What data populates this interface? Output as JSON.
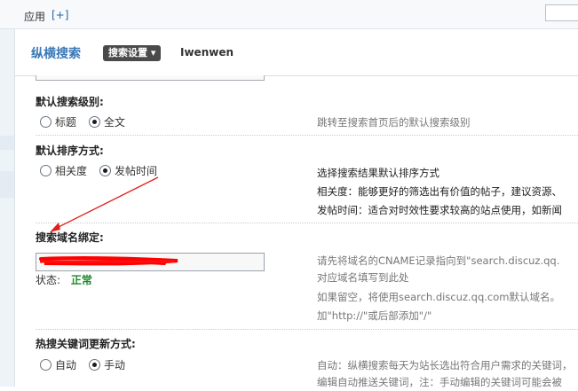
{
  "topbar": {
    "app_label": "应用",
    "add_label": "[+]"
  },
  "header": {
    "brand": "纵横搜索",
    "settings_button": "搜索设置 ▾",
    "username": "Iwenwen"
  },
  "search_level": {
    "label": "默认搜索级别:",
    "options": [
      {
        "label": "标题",
        "checked": false
      },
      {
        "label": "全文",
        "checked": true
      }
    ],
    "help": "跳转至搜索首页后的默认搜索级别"
  },
  "sort_order": {
    "label": "默认排序方式:",
    "options": [
      {
        "label": "相关度",
        "checked": false
      },
      {
        "label": "发帖时间",
        "checked": true
      }
    ],
    "help": [
      "选择搜索结果默认排序方式",
      "相关度：能够更好的筛选出有价值的帖子，建议资源、",
      "发帖时间：适合对时效性要求较高的站点使用，如新闻"
    ]
  },
  "domain_binding": {
    "label": "搜索域名绑定:",
    "status_label": "状态:",
    "status_value": "正常",
    "help": [
      "请先将域名的CNAME记录指向到\"search.discuz.qq.",
      "对应域名填写到此处",
      "如果留空，将使用search.discuz.qq.com默认域名。",
      "加\"http://\"或后部添加\"/\""
    ]
  },
  "hotword_update": {
    "label": "热搜关键词更新方式:",
    "options": [
      {
        "label": "自动",
        "checked": false
      },
      {
        "label": "手动",
        "checked": true
      }
    ],
    "help": [
      "自动：纵横搜索每天为站长选出符合用户需求的关键词，",
      "编辑自动推送关键词，注：手动编辑的关键词可能会被"
    ]
  },
  "annotation": {
    "arrow_color": "#e0201c",
    "scribble_color": "#ff0000"
  }
}
